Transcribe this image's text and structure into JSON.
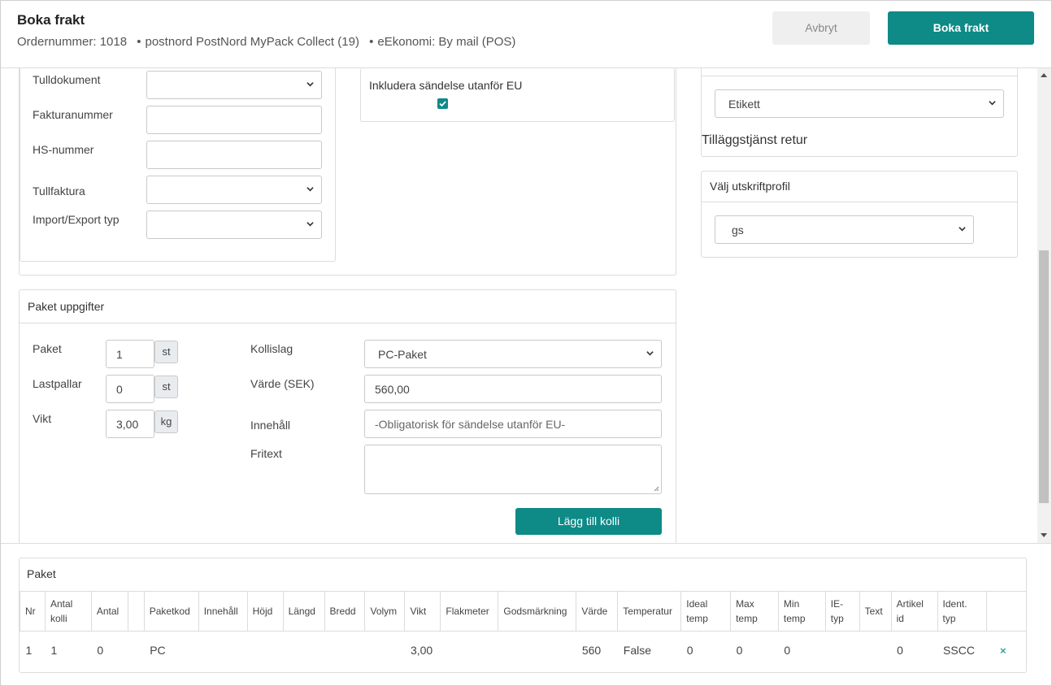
{
  "header": {
    "title": "Boka frakt",
    "order": "Ordernummer: 1018",
    "carrier": "postnord PostNord MyPack Collect (19)",
    "economy": "eEkonomi: By mail (POS)",
    "cancel_label": "Avbryt",
    "book_label": "Boka frakt"
  },
  "customs": {
    "tulldokument_label": "Tulldokument",
    "fakturanummer_label": "Fakturanummer",
    "hs_label": "HS-nummer",
    "tullfaktura_label": "Tullfaktura",
    "import_export_label": "Import/Export typ",
    "include_outside_eu_label": "Inkludera sändelse utanför EU",
    "include_outside_eu_checked": true
  },
  "right": {
    "etikett_value": "Etikett",
    "return_service_label": "Tilläggstjänst retur",
    "print_profile_title": "Välj utskriftprofil",
    "print_profile_value": "gs"
  },
  "package": {
    "title": "Paket uppgifter",
    "paket_label": "Paket",
    "paket_value": "1",
    "paket_unit": "st",
    "lastpallar_label": "Lastpallar",
    "lastpallar_value": "0",
    "lastpallar_unit": "st",
    "vikt_label": "Vikt",
    "vikt_value": "3,00",
    "vikt_unit": "kg",
    "kollislag_label": "Kollislag",
    "kollislag_value": "PC-Paket",
    "varde_label": "Värde (SEK)",
    "varde_value": "560,00",
    "innehall_label": "Innehåll",
    "innehall_placeholder": "-Obligatorisk för sändelse utanför EU-",
    "fritext_label": "Fritext",
    "add_button": "Lägg till kolli"
  },
  "table": {
    "title": "Paket",
    "columns": [
      "Nr",
      "Antal kolli",
      "Antal",
      "",
      "Paketkod",
      "Innehåll",
      "Höjd",
      "Längd",
      "Bredd",
      "Volym",
      "Vikt",
      "Flakmeter",
      "Godsmärkning",
      "Värde",
      "Temperatur",
      "Ideal temp",
      "Max temp",
      "Min temp",
      "IE-typ",
      "Text",
      "Artikel id",
      "Ident. typ",
      ""
    ],
    "rows": [
      [
        "1",
        "1",
        "0",
        "",
        "PC",
        "",
        "",
        "",
        "",
        "",
        "3,00",
        "",
        "",
        "560",
        "False",
        "0",
        "0",
        "0",
        "",
        "",
        "0",
        "SSCC"
      ]
    ]
  },
  "colors": {
    "primary": "#0e8a87",
    "remove_icon": "#2aa6a0"
  }
}
